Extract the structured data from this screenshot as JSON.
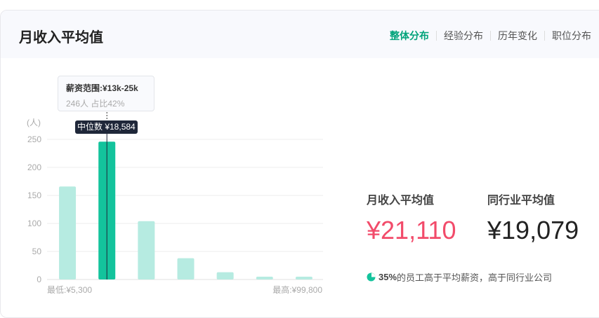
{
  "header": {
    "title": "月收入平均值",
    "tabs": [
      {
        "label": "整体分布",
        "active": true
      },
      {
        "label": "经验分布"
      },
      {
        "label": "历年变化"
      },
      {
        "label": "职位分布"
      }
    ]
  },
  "tooltip": {
    "range": "薪资范围:¥13k-25k",
    "detail": "246人  占比42%"
  },
  "median_label": "中位数 ¥18,584",
  "chart_data": {
    "type": "bar",
    "ylabel": "(人)",
    "ylim": [
      0,
      250
    ],
    "yticks": [
      "0",
      "50",
      "100",
      "150",
      "200",
      "250"
    ],
    "values": [
      166,
      246,
      104,
      38,
      13,
      5,
      5
    ],
    "highlight_index": 1,
    "min_label": "最低:¥5,300",
    "max_label": "最高:¥99,800",
    "colors": {
      "bar": "#b6ebe1",
      "highlight": "#13c39c"
    }
  },
  "stats": {
    "mine": {
      "label": "月收入平均值",
      "value": "¥21,110",
      "color": "#f24b6a"
    },
    "industry": {
      "label": "同行业平均值",
      "value": "¥19,079",
      "color": "#222222"
    }
  },
  "note": {
    "percent": "35%",
    "text": "的员工高于平均薪资，高于同行业公司",
    "icon": "pie-chart-icon"
  }
}
